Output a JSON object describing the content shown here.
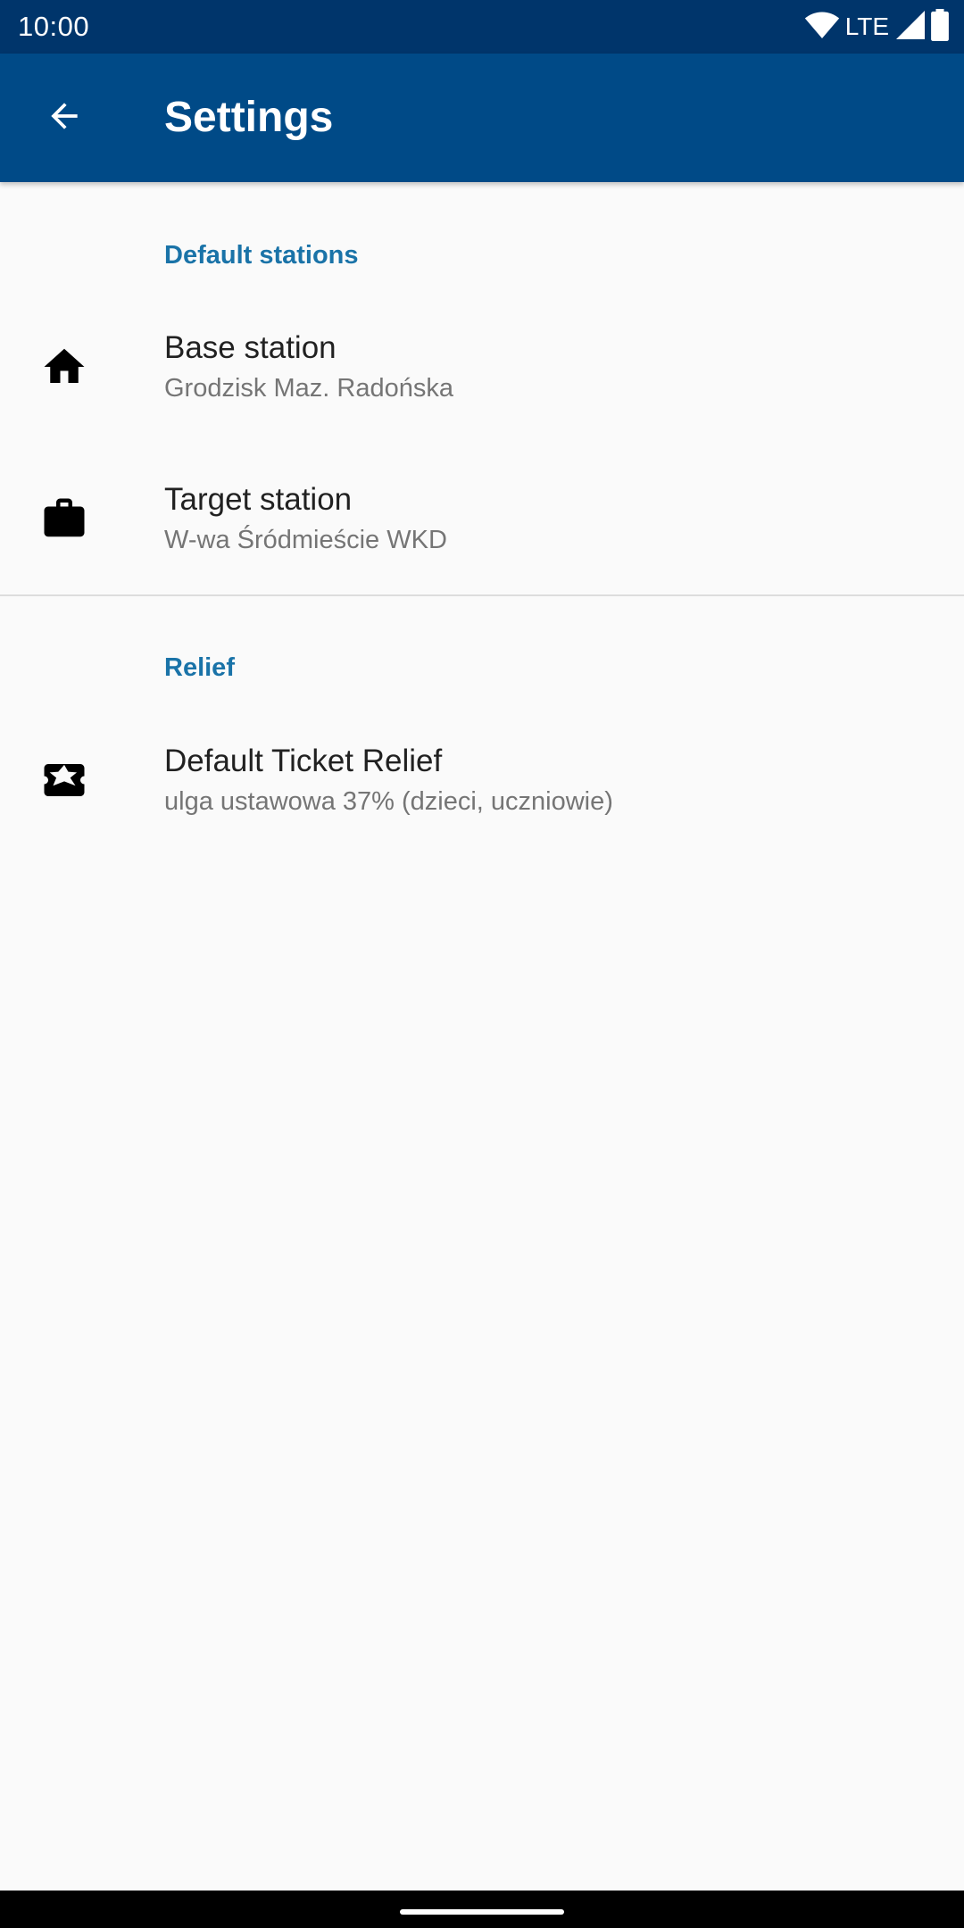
{
  "status_bar": {
    "time": "10:00",
    "network_label": "LTE",
    "icons": [
      "wifi-icon",
      "signal-icon",
      "battery-icon"
    ],
    "background_color": "#00356b"
  },
  "app_bar": {
    "title": "Settings",
    "back_icon": "arrow-back-icon",
    "background_color": "#004a87"
  },
  "sections": [
    {
      "header": "Default stations",
      "items": [
        {
          "icon": "home-icon",
          "title": "Base station",
          "summary": "Grodzisk Maz. Radońska"
        },
        {
          "icon": "briefcase-icon",
          "title": "Target station",
          "summary": "W-wa Śródmieście WKD"
        }
      ]
    },
    {
      "header": "Relief",
      "items": [
        {
          "icon": "ticket-star-icon",
          "title": "Default Ticket Relief",
          "summary": "ulga ustawowa 37% (dzieci, uczniowie)"
        }
      ]
    }
  ],
  "colors": {
    "accent": "#1a73a8",
    "title_text": "#212121",
    "summary_text": "#757575",
    "background": "#fafafa"
  }
}
